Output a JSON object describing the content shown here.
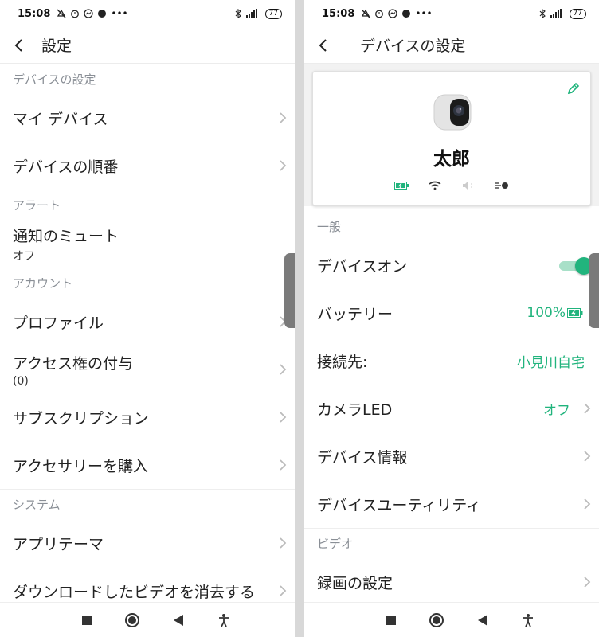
{
  "status_bar": {
    "time": "15:08",
    "battery": "77"
  },
  "left_screen": {
    "title": "設定",
    "sections": [
      {
        "header": "デバイスの設定",
        "items": [
          {
            "label": "マイ デバイス"
          },
          {
            "label": "デバイスの順番"
          }
        ]
      },
      {
        "header": "アラート",
        "items": [
          {
            "label": "通知のミュート",
            "sub": "オフ"
          }
        ]
      },
      {
        "header": "アカウント",
        "items": [
          {
            "label": "プロファイル"
          },
          {
            "label": "アクセス権の付与",
            "sub": "(0)"
          },
          {
            "label": "サブスクリプション"
          },
          {
            "label": "アクセサリーを購入"
          }
        ]
      },
      {
        "header": "システム",
        "items": [
          {
            "label": "アプリテーマ"
          },
          {
            "label": "ダウンロードしたビデオを消去する"
          }
        ]
      }
    ]
  },
  "right_screen": {
    "title": "デバイスの設定",
    "device_name": "太郎",
    "sections": [
      {
        "header": "一般",
        "items": [
          {
            "label": "デバイスオン",
            "toggle_on": true
          },
          {
            "label": "バッテリー",
            "value": "100%"
          },
          {
            "label": "接続先:",
            "value": "小見川自宅"
          },
          {
            "label": "カメラLED",
            "value": "オフ"
          },
          {
            "label": "デバイス情報"
          },
          {
            "label": "デバイスユーティリティ"
          }
        ]
      },
      {
        "header": "ビデオ",
        "items": [
          {
            "label": "録画の設定"
          }
        ]
      }
    ]
  },
  "icons": {
    "back": "back-arrow-icon",
    "chevron": "chevron-right-icon",
    "edit": "pencil-icon",
    "battery": "battery-charging-icon",
    "wifi": "wifi-icon",
    "speaker": "speaker-icon",
    "motion": "motion-sensor-icon",
    "nav_recents": "recents-square-icon",
    "nav_home": "home-circle-icon",
    "nav_back": "back-triangle-icon",
    "nav_accessibility": "accessibility-icon"
  },
  "colors": {
    "accent": "#21b47d",
    "section_text": "#8a8f96"
  }
}
